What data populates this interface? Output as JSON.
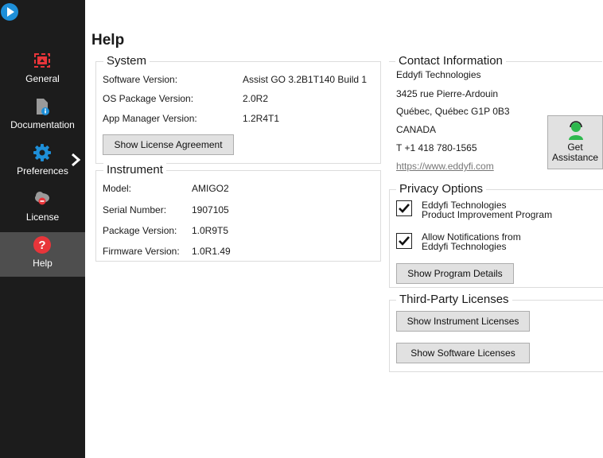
{
  "sidebar": {
    "items": [
      {
        "label": "General",
        "icon": "general-icon"
      },
      {
        "label": "Documentation",
        "icon": "documentation-icon"
      },
      {
        "label": "Preferences",
        "icon": "gear-icon"
      },
      {
        "label": "License",
        "icon": "license-icon"
      },
      {
        "label": "Help",
        "icon": "help-icon"
      }
    ],
    "active": "Help",
    "accent": "#e8353a"
  },
  "page": {
    "title": "Help"
  },
  "system": {
    "title": "System",
    "rows": [
      {
        "label": "Software Version:",
        "value": "Assist GO 3.2B1T140 Build 1"
      },
      {
        "label": "OS Package Version:",
        "value": "2.0R2"
      },
      {
        "label": "App Manager Version:",
        "value": "1.2R4T1"
      }
    ],
    "license_button": "Show License Agreement"
  },
  "instrument": {
    "title": "Instrument",
    "rows": [
      {
        "label": "Model:",
        "value": "AMIGO2"
      },
      {
        "label": "Serial Number:",
        "value": "1907105"
      },
      {
        "label": "Package Version:",
        "value": "1.0R9T5"
      },
      {
        "label": "Firmware Version:",
        "value": "1.0R1.49"
      }
    ]
  },
  "contact": {
    "title": "Contact Information",
    "company": "Eddyfi Technologies",
    "street": "3425 rue Pierre-Ardouin",
    "city": "Québec, Québec  G1P 0B3",
    "country": "CANADA",
    "phone": "T +1 418 780-1565",
    "website": "https://www.eddyfi.com",
    "assist_button": {
      "line1": "Get",
      "line2": "Assistance"
    }
  },
  "privacy": {
    "title": "Privacy Options",
    "options": [
      {
        "line1": "Eddyfi Technologies",
        "line2": "Product Improvement Program",
        "checked": true
      },
      {
        "line1": "Allow Notifications from",
        "line2": "Eddyfi Technologies",
        "checked": true
      }
    ],
    "details_button": "Show Program Details"
  },
  "third_party": {
    "title": "Third-Party Licenses",
    "instrument_button": "Show Instrument Licenses",
    "software_button": "Show Software Licenses"
  }
}
